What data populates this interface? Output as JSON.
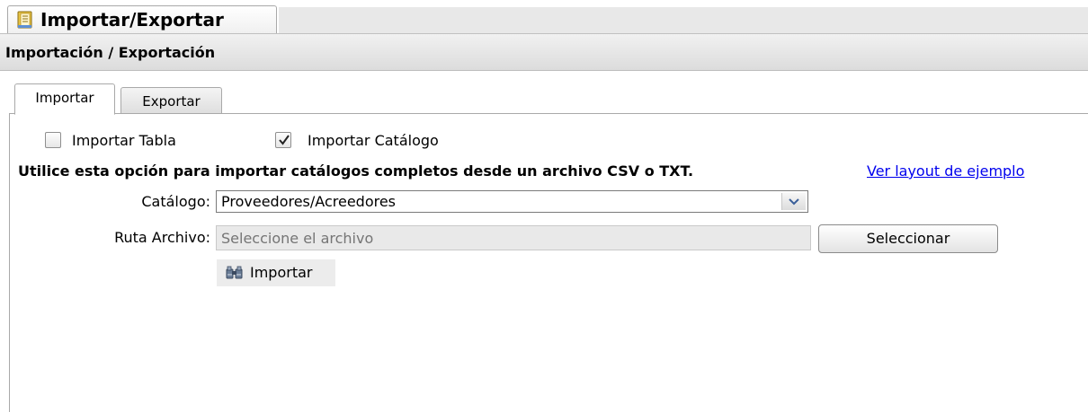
{
  "window": {
    "tab_title": "Importar/Exportar",
    "tab_icon": "notebook-icon"
  },
  "section": {
    "title": "Importación / Exportación"
  },
  "tabs": [
    {
      "label": "Importar",
      "active": true
    },
    {
      "label": "Exportar",
      "active": false
    }
  ],
  "options": {
    "import_table": {
      "label": "Importar Tabla",
      "checked": false
    },
    "import_catalog": {
      "label": "Importar Catálogo",
      "checked": true
    }
  },
  "instruction": "Utilice esta opción para importar catálogos completos desde un archivo CSV o TXT.",
  "layout_link": "Ver layout de ejemplo",
  "form": {
    "catalog_label": "Catálogo:",
    "catalog_value": "Proveedores/Acreedores",
    "path_label": "Ruta Archivo:",
    "path_placeholder": "Seleccione el archivo",
    "select_button": "Seleccionar",
    "import_button": "Importar",
    "import_icon": "import-binoculars-icon"
  },
  "colors": {
    "link": "#0000ee",
    "header_bg": "#e0e0e0"
  }
}
